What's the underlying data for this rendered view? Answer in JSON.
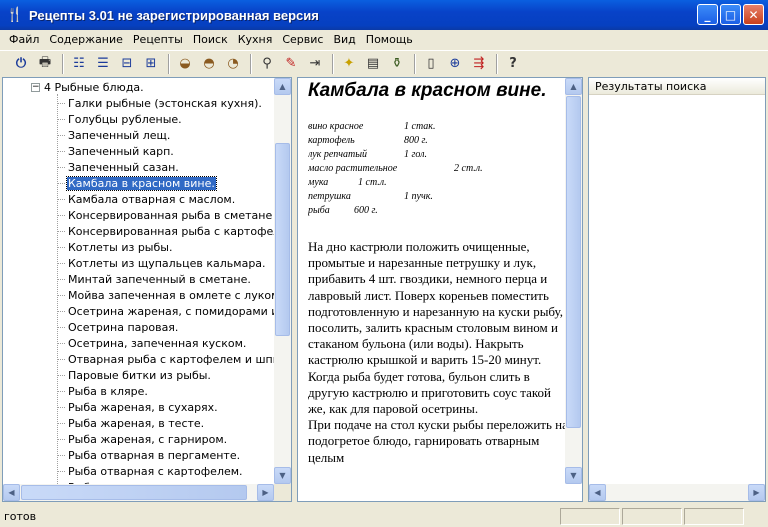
{
  "window": {
    "title": "Рецепты 3.01 не зарегистрированная версия"
  },
  "menu": [
    "Файл",
    "Содержание",
    "Рецепты",
    "Поиск",
    "Кухня",
    "Сервис",
    "Вид",
    "Помощь"
  ],
  "toolbar_icons": [
    "power-icon",
    "printer-icon",
    "expand-tree-icon",
    "collapse-tree-icon",
    "minimize-node-icon",
    "expand-node-icon",
    "bowl-icon",
    "pot-icon",
    "pan-icon",
    "binoculars-icon",
    "pen-icon",
    "indent-icon",
    "bulb-icon",
    "book-icon",
    "bottle-icon",
    "page-icon",
    "add-page-icon",
    "export-icon",
    "help-icon"
  ],
  "tree": {
    "root_label": "4 Рыбные блюда.",
    "items": [
      "Галки рыбные (эстонская кухня).",
      "Голубцы рубленые.",
      "Запеченный лещ.",
      "Запеченный карп.",
      "Запеченный сазан.",
      "Камбала в красном вине.",
      "Камбала отварная с маслом.",
      "Консервированная рыба в сметане с карт",
      "Консервированная рыба с картофелем.",
      "Котлеты из рыбы.",
      "Котлеты из щупальцев кальмара.",
      "Минтай запеченный в сметане.",
      "Мойва запеченная в омлете с луком.",
      "Осетрина жареная, с помидорами и луко",
      "Осетрина паровая.",
      "Осетрина, запеченная куском.",
      "Отварная рыба с картофелем и шпиком.",
      "Паровые битки из рыбы.",
      "Рыба в кляре.",
      "Рыба жареная, в сухарях.",
      "Рыба жареная, в тесте.",
      "Рыба жареная, с гарниром.",
      "Рыба отварная в пергаменте.",
      "Рыба отварная с картофелем.",
      "Рыба по-испански"
    ],
    "selected_index": 5
  },
  "recipe": {
    "title": "Камбала в красном вине.",
    "ingredients": [
      {
        "name": "вино красное",
        "qty": "1 стак."
      },
      {
        "name": "картофель",
        "qty": "800 г."
      },
      {
        "name": "лук репчатый",
        "qty": "1 гол."
      },
      {
        "name": "масло растительное",
        "qty": "2 ст.л."
      },
      {
        "name": "мука",
        "qty": "1 ст.л."
      },
      {
        "name": "петрушка",
        "qty": "1 пучк."
      },
      {
        "name": "рыба",
        "qty": "600 г."
      }
    ],
    "body": "На дно кастрюли положить очищенные, промытые и нарезанные петрушку и лук, прибавить 4 шт. гвоздики, немного перца и лавровый лист. Поверх кореньев поместить подготовленную и нарезанную на куски рыбу, посолить, залить красным столовым вином и стаканом бульона (или воды). Накрыть кастрюлю крышкой и варить 15-20 минут. Когда рыба будет готова, бульон слить в другую кастрюлю и приготовить соус такой же, как для паровой осетрины.",
    "body2": "При подаче на стол куски рыбы переложить на подогретое блюдо, гарнировать отварным целым"
  },
  "results": {
    "header": "Результаты поиска"
  },
  "status": {
    "text": "готов"
  }
}
